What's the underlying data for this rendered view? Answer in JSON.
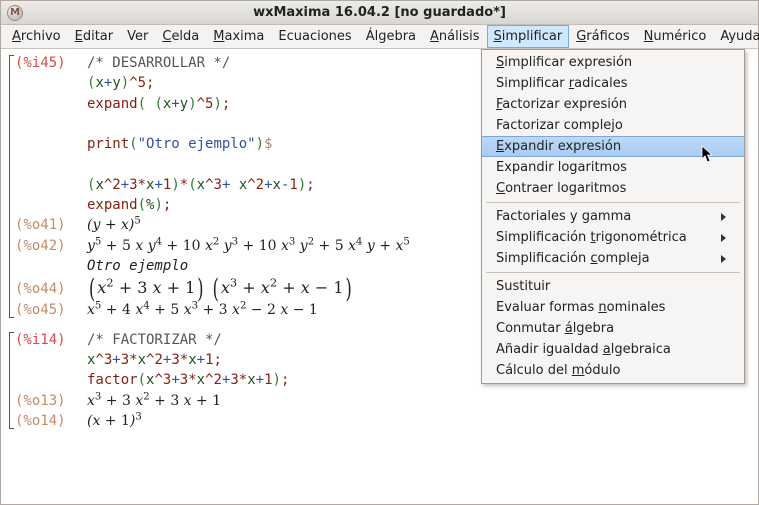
{
  "window": {
    "icon_letter": "M",
    "title": "wxMaxima 16.04.2 [no guardado*]"
  },
  "menu": {
    "items": [
      {
        "label": "Archivo",
        "u": 0
      },
      {
        "label": "Editar",
        "u": 0
      },
      {
        "label": "Ver",
        "u": -1
      },
      {
        "label": "Celda",
        "u": 0
      },
      {
        "label": "Maxima",
        "u": 0
      },
      {
        "label": "Ecuaciones",
        "u": -1
      },
      {
        "label": "Álgebra",
        "u": -1
      },
      {
        "label": "Análisis",
        "u": 0
      },
      {
        "label": "Simplificar",
        "u": 0,
        "active": true
      },
      {
        "label": "Gráficos",
        "u": 0
      },
      {
        "label": "Numérico",
        "u": 0
      },
      {
        "label": "Ayuda",
        "u": -1
      }
    ]
  },
  "dropdown": {
    "sections": [
      [
        {
          "label": "Simplificar expresión",
          "u": 0
        },
        {
          "label": "Simplificar radicales",
          "u": 12
        },
        {
          "label": "Factorizar expresión",
          "u": 0
        },
        {
          "label": "Factorizar complejo",
          "u": -1
        },
        {
          "label": "Expandir expresión",
          "u": 0,
          "highlight": true
        },
        {
          "label": "Expandir logaritmos",
          "u": -1
        },
        {
          "label": "Contraer logaritmos",
          "u": 0
        }
      ],
      [
        {
          "label": "Factoriales y gamma",
          "u": -1,
          "submenu": true
        },
        {
          "label": "Simplificación trigonométrica",
          "u": 15,
          "submenu": true
        },
        {
          "label": "Simplificación compleja",
          "u": 15,
          "submenu": true
        }
      ],
      [
        {
          "label": "Sustituir",
          "u": -1
        },
        {
          "label": "Evaluar formas nominales",
          "u": 15
        },
        {
          "label": "Conmutar álgebra",
          "u": 9
        },
        {
          "label": "Añadir igualdad algebraica",
          "u": 16
        },
        {
          "label": "Cálculo del módulo",
          "u": 12
        }
      ]
    ]
  },
  "cells": [
    {
      "label": "(%i45)",
      "kind": "in",
      "code_lines": [
        [
          {
            "t": "/* DESARROLLAR */",
            "c": "c-comment"
          }
        ],
        [
          {
            "t": "(",
            "c": "c-paren"
          },
          {
            "t": "x",
            "c": "c-sym"
          },
          {
            "t": "+",
            "c": "c-op"
          },
          {
            "t": "y",
            "c": "c-sym"
          },
          {
            "t": ")",
            "c": "c-paren"
          },
          {
            "t": "^5;",
            "c": "c-red"
          }
        ],
        [
          {
            "t": "expand",
            "c": "c-red"
          },
          {
            "t": "( ",
            "c": "c-paren"
          },
          {
            "t": "(",
            "c": "c-paren"
          },
          {
            "t": "x",
            "c": "c-sym"
          },
          {
            "t": "+",
            "c": "c-op"
          },
          {
            "t": "y",
            "c": "c-sym"
          },
          {
            "t": ")",
            "c": "c-paren"
          },
          {
            "t": "^5",
            "c": "c-red"
          },
          {
            "t": ")",
            "c": "c-paren"
          },
          {
            "t": ";",
            "c": "c-red"
          }
        ],
        [
          {
            "t": " ",
            "c": ""
          }
        ],
        [
          {
            "t": "print",
            "c": "c-red"
          },
          {
            "t": "(",
            "c": "c-paren"
          },
          {
            "t": "\"Otro ejemplo\"",
            "c": "c-str"
          },
          {
            "t": ")",
            "c": "c-paren"
          },
          {
            "t": "$",
            "c": "c-dollar"
          }
        ],
        [
          {
            "t": " ",
            "c": ""
          }
        ],
        [
          {
            "t": "(",
            "c": "c-paren"
          },
          {
            "t": "x",
            "c": "c-sym"
          },
          {
            "t": "^2",
            "c": "c-red"
          },
          {
            "t": "+",
            "c": "c-op"
          },
          {
            "t": "3*",
            "c": "c-red"
          },
          {
            "t": "x",
            "c": "c-sym"
          },
          {
            "t": "+",
            "c": "c-op"
          },
          {
            "t": "1",
            "c": "c-red"
          },
          {
            "t": ")",
            "c": "c-paren"
          },
          {
            "t": "*",
            "c": "c-red"
          },
          {
            "t": "(",
            "c": "c-paren"
          },
          {
            "t": "x",
            "c": "c-sym"
          },
          {
            "t": "^3",
            "c": "c-red"
          },
          {
            "t": "+ ",
            "c": "c-op"
          },
          {
            "t": "x",
            "c": "c-sym"
          },
          {
            "t": "^2",
            "c": "c-red"
          },
          {
            "t": "+",
            "c": "c-op"
          },
          {
            "t": "x",
            "c": "c-sym"
          },
          {
            "t": "-",
            "c": "c-op"
          },
          {
            "t": "1",
            "c": "c-red"
          },
          {
            "t": ")",
            "c": "c-paren"
          },
          {
            "t": ";",
            "c": "c-red"
          }
        ],
        [
          {
            "t": "expand",
            "c": "c-red"
          },
          {
            "t": "(",
            "c": "c-paren"
          },
          {
            "t": "%",
            "c": "c-sym"
          },
          {
            "t": ")",
            "c": "c-paren"
          },
          {
            "t": ";",
            "c": "c-red"
          }
        ]
      ],
      "outputs": [
        {
          "label": "(%o41)",
          "math": "(y + x)<sup>5</sup>",
          "big": false,
          "plain": false
        },
        {
          "label": "(%o42)",
          "math": "y<sup>5</sup> + <span class='n'>5</span> x y<sup>4</sup> + <span class='n'>10</span> x<sup>2</sup> y<sup>3</sup> + <span class='n'>10</span> x<sup>3</sup> y<sup>2</sup> + <span class='n'>5</span> x<sup>4</sup> y + x<sup>5</sup>",
          "big": false,
          "plain": false
        },
        {
          "label": "",
          "math": "Otro ejemplo",
          "plain": true,
          "big": false
        },
        {
          "label": "(%o44)",
          "math": "<span class='lparen'>(</span>x<sup>2</sup> + <span class='n'>3</span> x + <span class='n'>1</span><span class='rparen'>)</span> <span class='lparen'>(</span>x<sup>3</sup> + x<sup>2</sup> + x − <span class='n'>1</span><span class='rparen'>)</span>",
          "big": true,
          "plain": false
        },
        {
          "label": "(%o45)",
          "math": "x<sup>5</sup> + <span class='n'>4</span> x<sup>4</sup> + <span class='n'>5</span> x<sup>3</sup> + <span class='n'>3</span> x<sup>2</sup> − <span class='n'>2</span> x − <span class='n'>1</span>",
          "big": false,
          "plain": false
        }
      ]
    },
    {
      "label": "(%i14)",
      "kind": "in",
      "code_lines": [
        [
          {
            "t": "/* FACTORIZAR */",
            "c": "c-comment"
          }
        ],
        [
          {
            "t": "x",
            "c": "c-sym"
          },
          {
            "t": "^3",
            "c": "c-red"
          },
          {
            "t": "+",
            "c": "c-op"
          },
          {
            "t": "3*",
            "c": "c-red"
          },
          {
            "t": "x",
            "c": "c-sym"
          },
          {
            "t": "^2",
            "c": "c-red"
          },
          {
            "t": "+",
            "c": "c-op"
          },
          {
            "t": "3*",
            "c": "c-red"
          },
          {
            "t": "x",
            "c": "c-sym"
          },
          {
            "t": "+",
            "c": "c-op"
          },
          {
            "t": "1",
            "c": "c-red"
          },
          {
            "t": ";",
            "c": "c-red"
          }
        ],
        [
          {
            "t": "factor",
            "c": "c-red"
          },
          {
            "t": "(",
            "c": "c-paren"
          },
          {
            "t": "x",
            "c": "c-sym"
          },
          {
            "t": "^3",
            "c": "c-red"
          },
          {
            "t": "+",
            "c": "c-op"
          },
          {
            "t": "3*",
            "c": "c-red"
          },
          {
            "t": "x",
            "c": "c-sym"
          },
          {
            "t": "^2",
            "c": "c-red"
          },
          {
            "t": "+",
            "c": "c-op"
          },
          {
            "t": "3*",
            "c": "c-red"
          },
          {
            "t": "x",
            "c": "c-sym"
          },
          {
            "t": "+",
            "c": "c-op"
          },
          {
            "t": "1",
            "c": "c-red"
          },
          {
            "t": ")",
            "c": "c-paren"
          },
          {
            "t": ";",
            "c": "c-red"
          }
        ]
      ],
      "outputs": [
        {
          "label": "(%o13)",
          "math": "x<sup>3</sup> + <span class='n'>3</span> x<sup>2</sup> + <span class='n'>3</span> x + <span class='n'>1</span>",
          "big": false,
          "plain": false
        },
        {
          "label": "(%o14)",
          "math": "(x + <span class='n'>1</span>)<sup>3</sup>",
          "big": false,
          "plain": false
        }
      ]
    }
  ]
}
